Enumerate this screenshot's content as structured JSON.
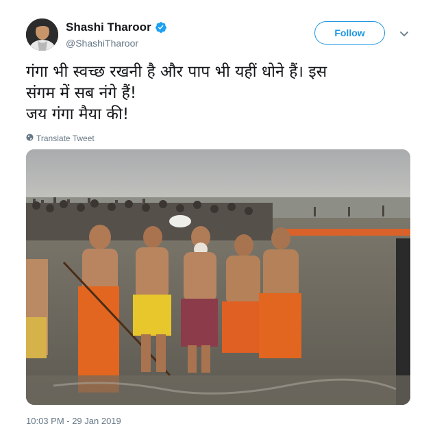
{
  "author": {
    "display_name": "Shashi Tharoor",
    "handle": "@ShashiTharoor",
    "verified": true,
    "avatar_icon": "profile-photo"
  },
  "actions": {
    "follow_label": "Follow",
    "menu_icon": "chevron-down-icon"
  },
  "tweet": {
    "lines": [
      "गंगा भी स्वच्छ रखनी है और पाप भी यहीं धोने हैं। इस",
      "संगम में सब नंगे हैं!",
      "जय गंगा मैया की!"
    ],
    "translate_label": "Translate Tweet",
    "timestamp": "10:03 PM - 29 Jan 2019"
  },
  "colors": {
    "link_blue": "#1b95e0",
    "verified_blue": "#1da1f2",
    "secondary_text": "#657786"
  }
}
